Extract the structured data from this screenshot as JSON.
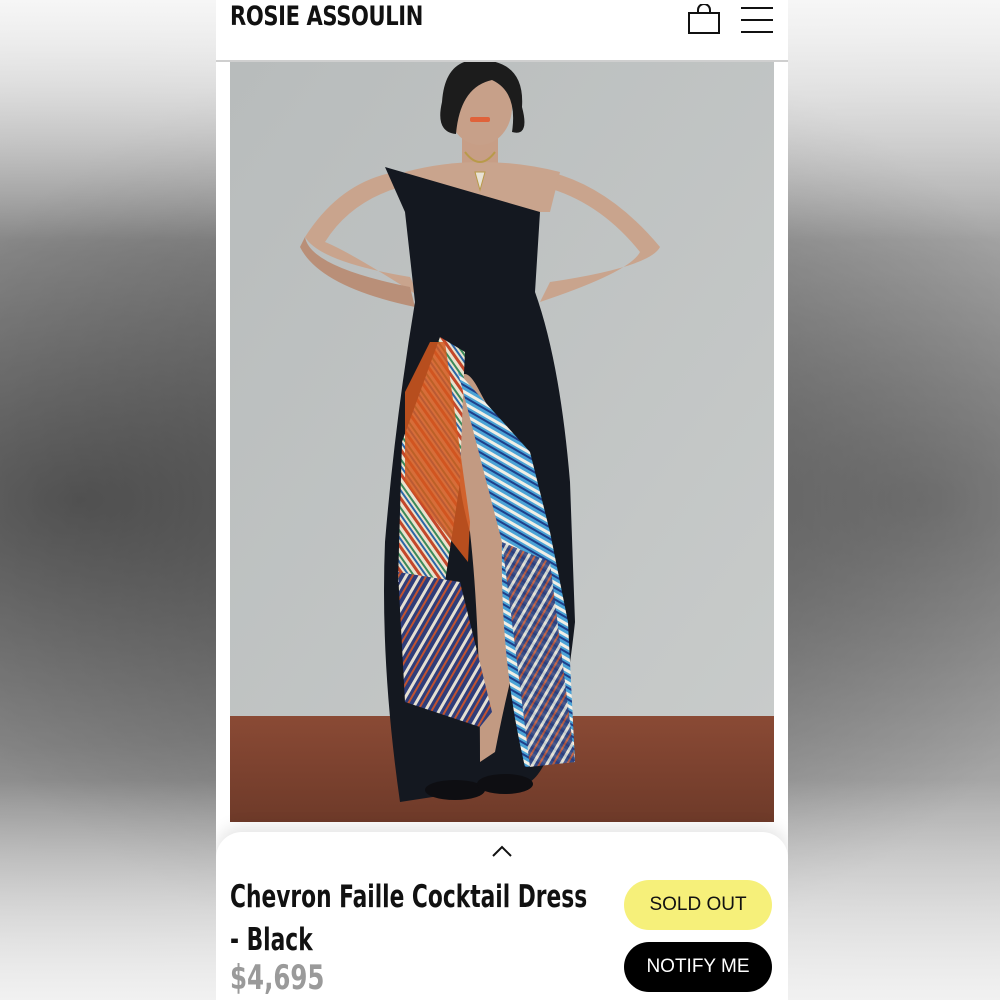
{
  "brand": {
    "logo_text": "ROSIE ASSOULIN"
  },
  "header": {
    "bag_icon": "shopping-bag-icon",
    "menu_icon": "hamburger-menu-icon"
  },
  "product": {
    "title": "Chevron Faille Cocktail Dress - Black",
    "price": "$4,695",
    "sold_out_label": "SOLD OUT",
    "notify_label": "NOTIFY ME",
    "image_alt": "Model wearing strapless black dress with striped chevron panel"
  },
  "panel": {
    "expand_icon": "chevron-up-icon"
  },
  "colors": {
    "sold_out_bg": "#f6f07a",
    "notify_bg": "#000000",
    "price": "#9a9a9a"
  }
}
